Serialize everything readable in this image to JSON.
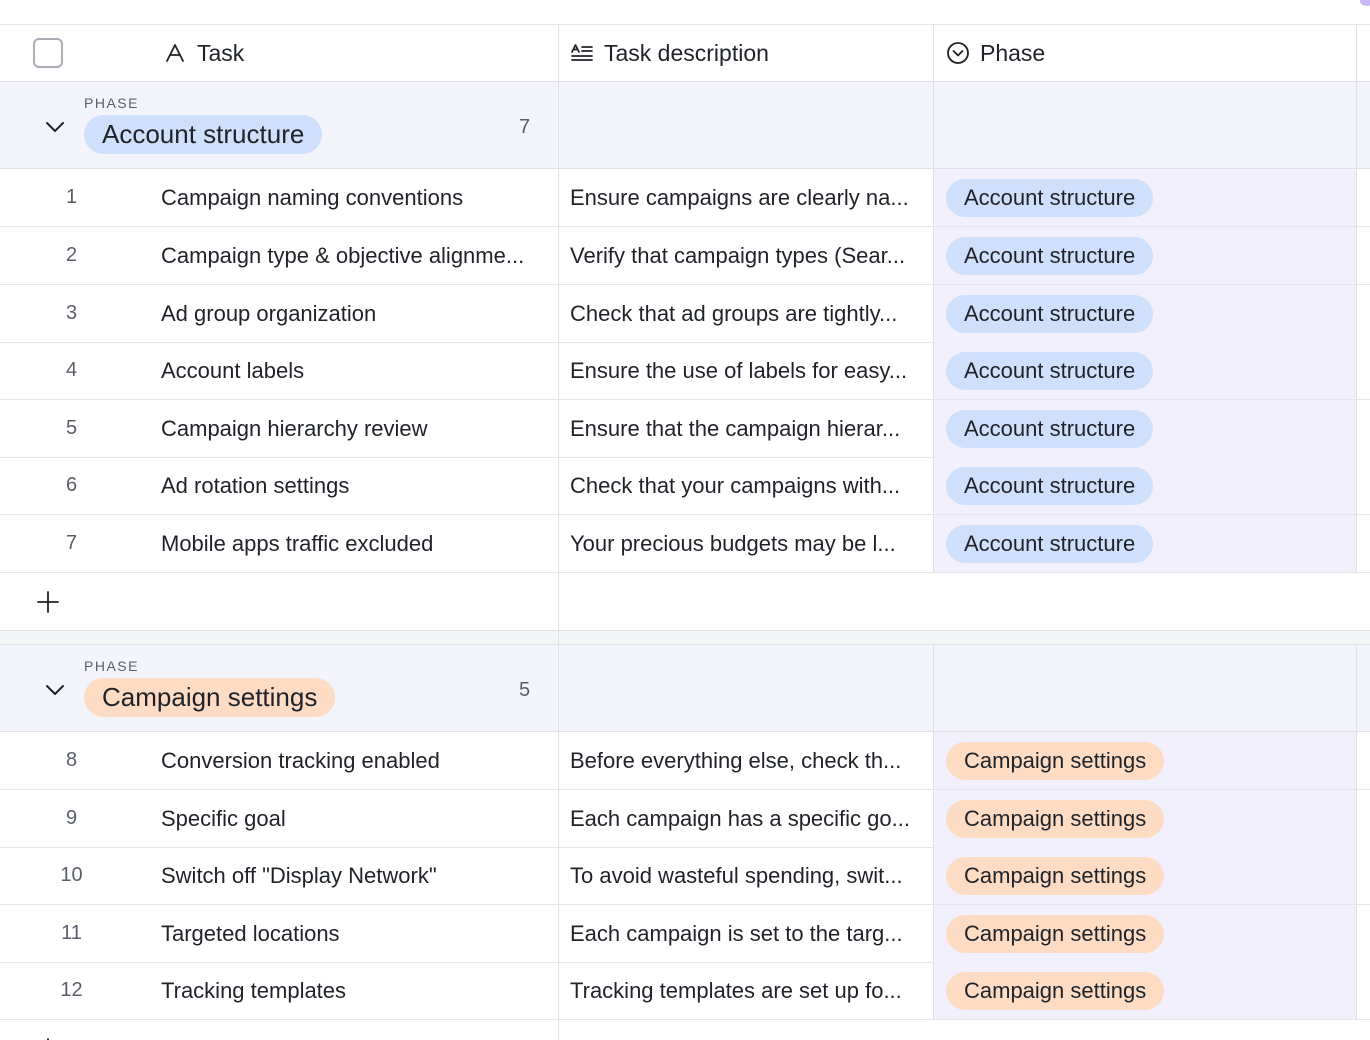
{
  "header": {
    "task_label": "Task",
    "description_label": "Task description",
    "phase_label": "Phase"
  },
  "groups": [
    {
      "group_label": "PHASE",
      "name": "Account structure",
      "count": "7",
      "color": "#cfe0fc",
      "rows": [
        {
          "num": "1",
          "task": "Campaign naming conventions",
          "desc": "Ensure campaigns are clearly na...",
          "phase": "Account structure"
        },
        {
          "num": "2",
          "task": "Campaign type & objective alignme...",
          "desc": "Verify that campaign types (Sear...",
          "phase": "Account structure"
        },
        {
          "num": "3",
          "task": "Ad group organization",
          "desc": "Check that ad groups are tightly...",
          "phase": "Account structure"
        },
        {
          "num": "4",
          "task": "Account labels",
          "desc": "Ensure the use of labels for easy...",
          "phase": "Account structure"
        },
        {
          "num": "5",
          "task": "Campaign hierarchy review",
          "desc": "Ensure that the campaign hierar...",
          "phase": "Account structure"
        },
        {
          "num": "6",
          "task": "Ad rotation settings",
          "desc": "Check that your campaigns with...",
          "phase": "Account structure"
        },
        {
          "num": "7",
          "task": "Mobile apps traffic excluded",
          "desc": "Your precious budgets may be l...",
          "phase": "Account structure"
        }
      ]
    },
    {
      "group_label": "PHASE",
      "name": "Campaign settings",
      "count": "5",
      "color": "#fddcc3",
      "rows": [
        {
          "num": "8",
          "task": "Conversion tracking enabled",
          "desc": "Before everything else, check th...",
          "phase": "Campaign settings"
        },
        {
          "num": "9",
          "task": "Specific goal",
          "desc": "Each campaign has a specific go...",
          "phase": "Campaign settings"
        },
        {
          "num": "10",
          "task": "Switch off \"Display Network\"",
          "desc": "To avoid wasteful spending, swit...",
          "phase": "Campaign settings"
        },
        {
          "num": "11",
          "task": "Targeted locations",
          "desc": "Each campaign is set to the targ...",
          "phase": "Campaign settings"
        },
        {
          "num": "12",
          "task": "Tracking templates",
          "desc": "Tracking templates are set up fo...",
          "phase": "Campaign settings"
        }
      ]
    }
  ],
  "icons": {
    "task_column": "text-type-icon",
    "description_column": "long-text-icon",
    "phase_column": "single-select-icon",
    "group_toggle": "chevron-down-icon",
    "add_row": "plus-icon"
  }
}
